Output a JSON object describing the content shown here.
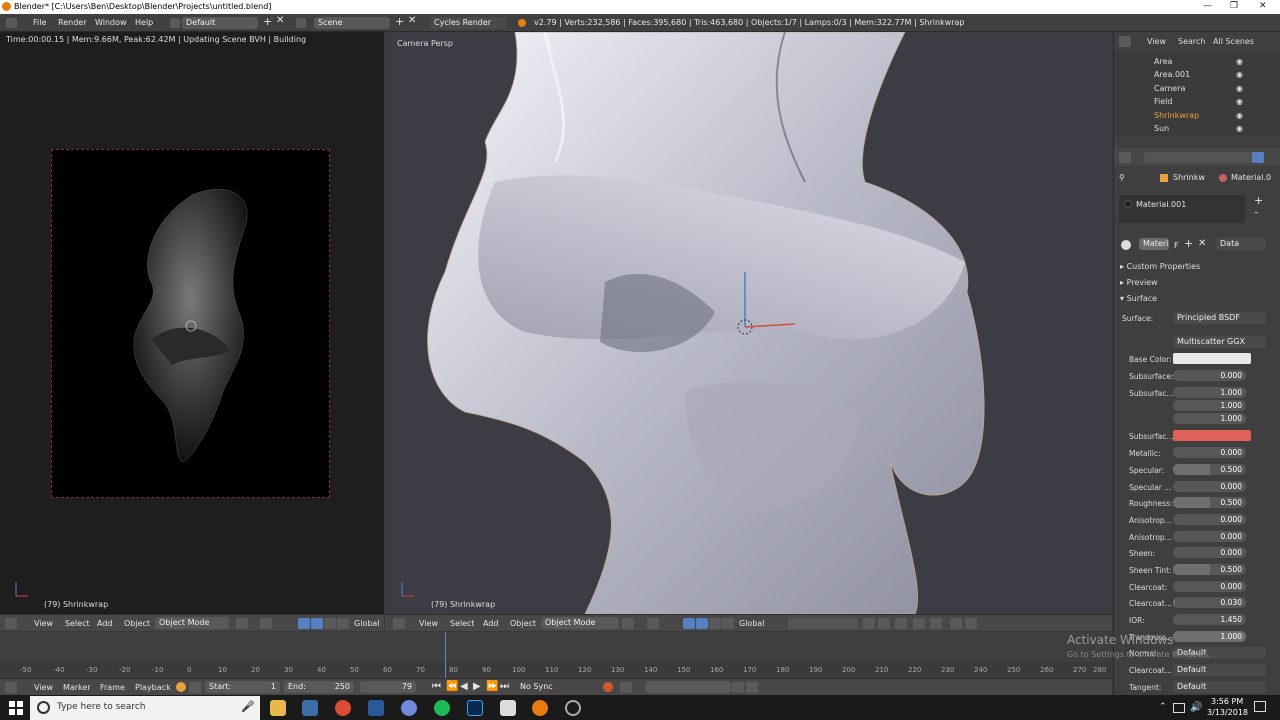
{
  "window": {
    "title": "Blender* [C:\\Users\\Ben\\Desktop\\Blender\\Projects\\untitled.blend]"
  },
  "info_header": {
    "menus": [
      "File",
      "Render",
      "Window",
      "Help"
    ],
    "layout": "Default",
    "scene": "Scene",
    "engine": "Cycles Render",
    "stats": "v2.79 | Verts:232,586 | Faces:395,680 | Tris:463,680 | Objects:1/7 | Lamps:0/3 | Mem:322.77M | Shrinkwrap"
  },
  "render_view": {
    "status": "Time:00:00.15 | Mem:9.66M, Peak:62.42M | Updating Scene BVH | Building",
    "object_label": "(79) Shrinkwrap",
    "header_items": [
      "View",
      "Select",
      "Add",
      "Object"
    ],
    "mode": "Object Mode",
    "orientation": "Global"
  },
  "viewport": {
    "label": "Camera Persp",
    "object_label": "(79) Shrinkwrap",
    "header_items": [
      "View",
      "Select",
      "Add",
      "Object"
    ],
    "mode": "Object Mode",
    "orientation": "Global"
  },
  "timeline": {
    "ticks": [
      "-50",
      "-40",
      "-30",
      "-20",
      "-10",
      "0",
      "10",
      "20",
      "30",
      "40",
      "50",
      "60",
      "70",
      "80",
      "90",
      "100",
      "110",
      "120",
      "130",
      "140",
      "150",
      "160",
      "170",
      "180",
      "190",
      "200",
      "210",
      "220",
      "230",
      "240",
      "250",
      "260",
      "270",
      "280"
    ],
    "menu": [
      "View",
      "Marker",
      "Frame",
      "Playback"
    ],
    "start_label": "Start:",
    "start": "1",
    "end_label": "End:",
    "end": "250",
    "current": "79",
    "sync": "No Sync"
  },
  "outliner": {
    "tabs": [
      "View",
      "Search",
      "All Scenes"
    ],
    "items": [
      "Area",
      "Area.001",
      "Camera",
      "Field",
      "Shrinkwrap",
      "Sun"
    ]
  },
  "properties": {
    "breadcrumb_object": "Shrinkw",
    "breadcrumb_material": "Material.0",
    "material_slot": "Material.001",
    "material_field": "Materia",
    "material_field_f": "F",
    "data_dropdown": "Data",
    "sections": [
      "Custom Properties",
      "Preview",
      "Surface"
    ],
    "surface_label": "Surface:",
    "surface_value": "Principled BSDF",
    "distribution": "Multiscatter GGX",
    "base_color_label": "Base Color:",
    "base_color": "#e8e8e8",
    "subsurface_color": "#e0615a",
    "params": [
      {
        "label": "Subsurface:",
        "value": "0.000",
        "level": 0
      },
      {
        "label": "Subsurfac...",
        "value": "1.000",
        "level": 1
      },
      {
        "label": "Subsurfac...",
        "value": "",
        "level": 0
      },
      {
        "label": "Metallic:",
        "value": "0.000",
        "level": 0
      },
      {
        "label": "Specular:",
        "value": "0.500",
        "level": 0.5
      },
      {
        "label": "Specular ...",
        "value": "0.000",
        "level": 0
      },
      {
        "label": "Roughness:",
        "value": "0.500",
        "level": 0.5
      },
      {
        "label": "Anisotrop...",
        "value": "0.000",
        "level": 0
      },
      {
        "label": "Anisotrop...",
        "value": "0.000",
        "level": 0
      },
      {
        "label": "Sheen:",
        "value": "0.000",
        "level": 0
      },
      {
        "label": "Sheen Tint:",
        "value": "0.500",
        "level": 0.5
      },
      {
        "label": "Clearcoat:",
        "value": "0.000",
        "level": 0
      },
      {
        "label": "Clearcoat...",
        "value": "0.030",
        "level": 0.03
      },
      {
        "label": "IOR:",
        "value": "1.450",
        "level": 0.3
      },
      {
        "label": "Transmiss...",
        "value": "1.000",
        "level": 1
      }
    ],
    "radius_values": [
      "1.000",
      "1.000",
      "1.000"
    ],
    "normal_label": "Normal:",
    "normal_value": "Default",
    "clearcoat_normal_label": "Clearcoat...",
    "clearcoat_normal_value": "Default",
    "tangent_label": "Tangent:",
    "tangent_value": "Default"
  },
  "watermark": {
    "title": "Activate Windows",
    "subtitle": "Go to Settings to activate Windows."
  },
  "taskbar": {
    "search_placeholder": "Type here to search",
    "time": "3:56 PM",
    "date": "3/13/2018"
  }
}
